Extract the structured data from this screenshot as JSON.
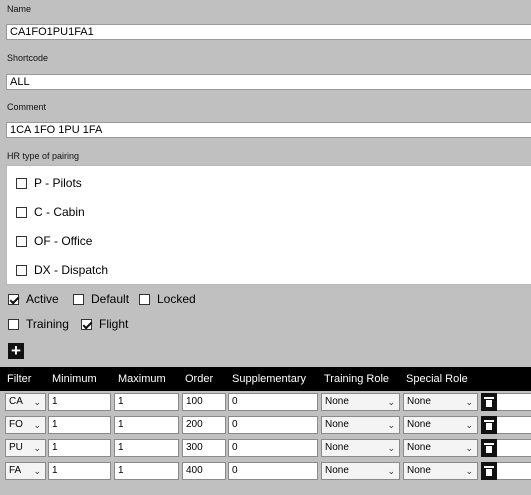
{
  "fields": {
    "name": {
      "label": "Name",
      "value": "CA1FO1PU1FA1"
    },
    "shortcode": {
      "label": "Shortcode",
      "value": "ALL"
    },
    "comment": {
      "label": "Comment",
      "value": "1CA 1FO 1PU 1FA"
    }
  },
  "hr_type": {
    "label": "HR type of pairing",
    "items": [
      {
        "label": "P - Pilots",
        "checked": false
      },
      {
        "label": "C - Cabin",
        "checked": false
      },
      {
        "label": "OF - Office",
        "checked": false
      },
      {
        "label": "DX - Dispatch",
        "checked": false
      }
    ]
  },
  "options": {
    "active": {
      "label": "Active",
      "checked": true
    },
    "default": {
      "label": "Default",
      "checked": false
    },
    "locked": {
      "label": "Locked",
      "checked": false
    },
    "training": {
      "label": "Training",
      "checked": false
    },
    "flight": {
      "label": "Flight",
      "checked": true
    }
  },
  "add_icon": "plus-icon",
  "table": {
    "headers": {
      "filter": "Filter",
      "minimum": "Minimum",
      "maximum": "Maximum",
      "order": "Order",
      "supplementary": "Supplementary",
      "training_role": "Training Role",
      "special_role": "Special Role"
    },
    "rows": [
      {
        "filter": "CA",
        "minimum": "1",
        "maximum": "1",
        "order": "100",
        "supplementary": "0",
        "training_role": "None",
        "special_role": "None"
      },
      {
        "filter": "FO",
        "minimum": "1",
        "maximum": "1",
        "order": "200",
        "supplementary": "0",
        "training_role": "None",
        "special_role": "None"
      },
      {
        "filter": "PU",
        "minimum": "1",
        "maximum": "1",
        "order": "300",
        "supplementary": "0",
        "training_role": "None",
        "special_role": "None"
      },
      {
        "filter": "FA",
        "minimum": "1",
        "maximum": "1",
        "order": "400",
        "supplementary": "0",
        "training_role": "None",
        "special_role": "None"
      }
    ],
    "delete_icon": "trash-icon"
  }
}
